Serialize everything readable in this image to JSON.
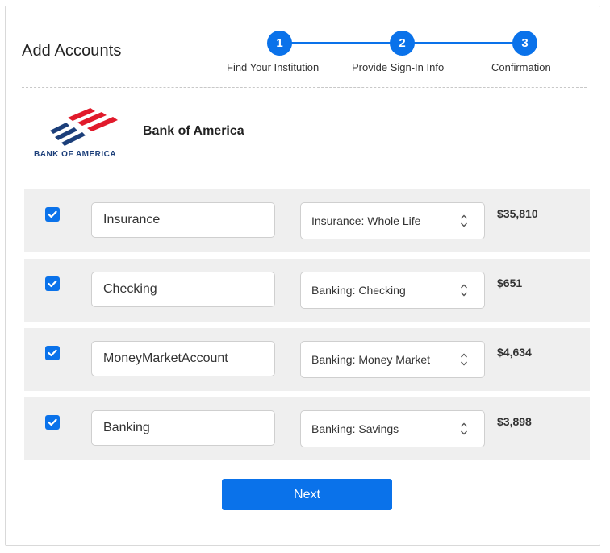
{
  "header": {
    "title": "Add Accounts"
  },
  "stepper": {
    "steps": [
      {
        "number": "1",
        "label": "Find Your Institution"
      },
      {
        "number": "2",
        "label": "Provide Sign-In Info"
      },
      {
        "number": "3",
        "label": "Confirmation"
      }
    ],
    "accent_color": "#0a72ea"
  },
  "bank": {
    "logo_text": "BANK OF AMERICA",
    "name": "Bank of America"
  },
  "accounts": [
    {
      "checked": true,
      "name": "Insurance",
      "type": "Insurance: Whole Life",
      "amount": "$35,810"
    },
    {
      "checked": true,
      "name": "Checking",
      "type": "Banking: Checking",
      "amount": "$651"
    },
    {
      "checked": true,
      "name": "MoneyMarketAccount",
      "type": "Banking: Money Market",
      "amount": "$4,634"
    },
    {
      "checked": true,
      "name": "Banking",
      "type": "Banking: Savings",
      "amount": "$3,898"
    }
  ],
  "footer": {
    "next_label": "Next"
  },
  "icons": {
    "checkbox": "checkmark-icon",
    "select": "updown-chevron-icon"
  }
}
